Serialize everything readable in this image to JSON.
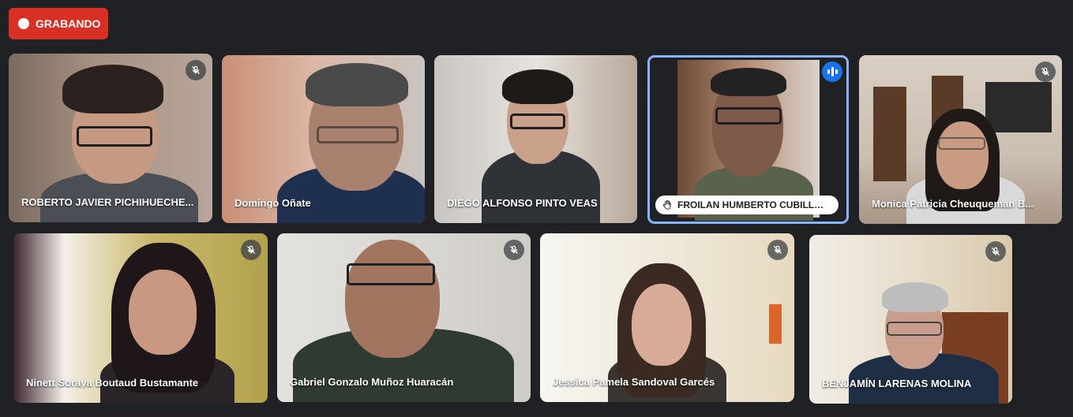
{
  "recording": {
    "label": "GRABANDO",
    "color": "#d93025"
  },
  "accent": "#8ab4f8",
  "participants": [
    {
      "name": "ROBERTO JAVIER PICHIHUECHE...",
      "muted": true
    },
    {
      "name": "Domingo Oñate",
      "muted": false
    },
    {
      "name": "DIEGO ALFONSO PINTO VEAS",
      "muted": false
    },
    {
      "name": "FROILAN HUMBERTO CUBILLO...",
      "muted": false,
      "speaking": true,
      "hand_raised": true
    },
    {
      "name": "Monica Patricia Cheuqueman B...",
      "muted": true
    },
    {
      "name": "Ninett Soraya Boutaud Bustamante",
      "muted": true
    },
    {
      "name": "Gabriel Gonzalo Muñoz Huaracán",
      "muted": true
    },
    {
      "name": "Jessica Pamela Sandoval Garcés",
      "muted": true
    },
    {
      "name": "BENJAMÍN LARENAS MOLINA",
      "muted": true
    }
  ],
  "icons": {
    "mute": "mic-off-icon",
    "hand": "raised-hand-icon",
    "speaking": "audio-level-icon",
    "record": "record-dot-icon"
  }
}
